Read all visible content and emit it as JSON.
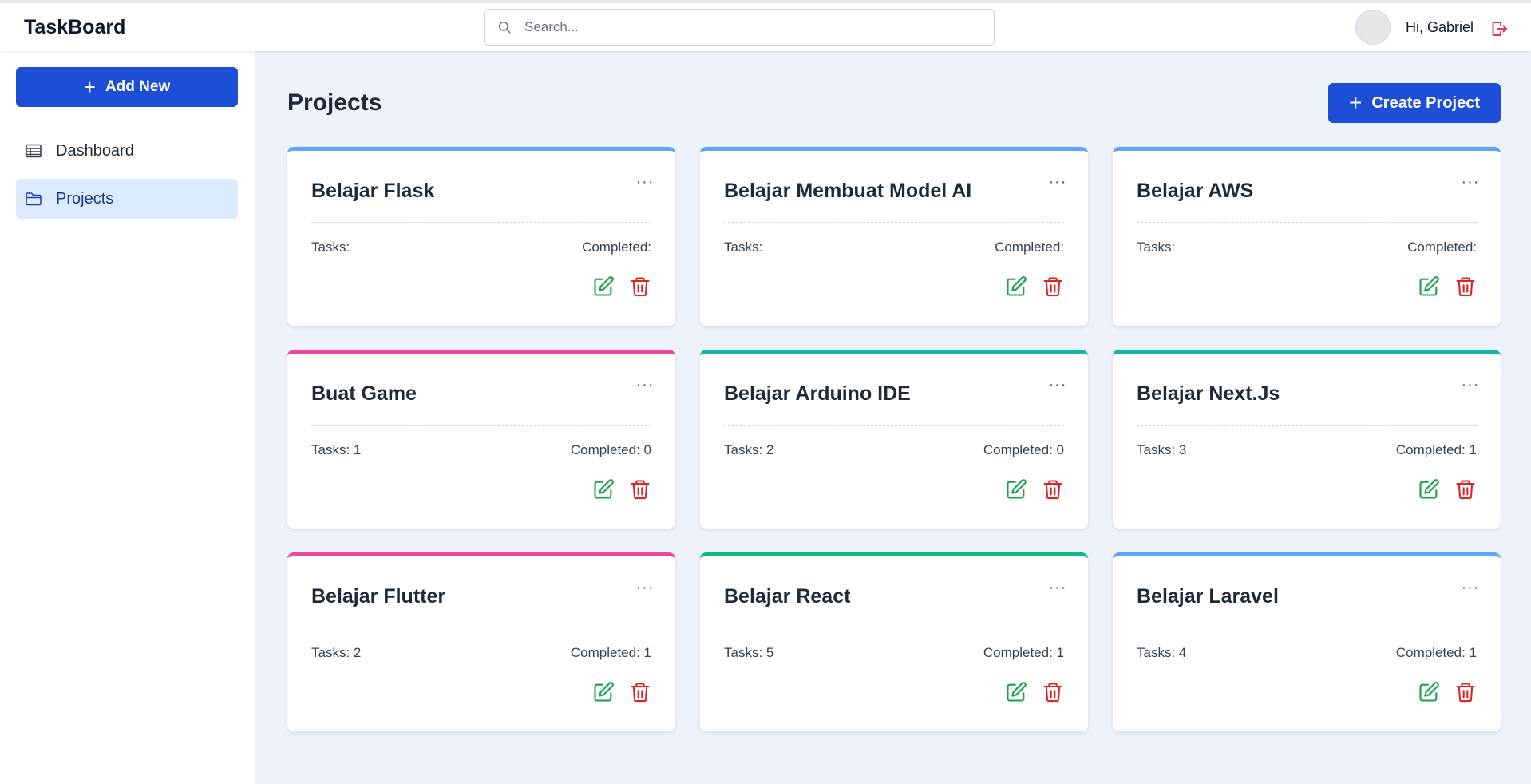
{
  "app": {
    "brand": "TaskBoard"
  },
  "search": {
    "placeholder": "Search..."
  },
  "user": {
    "greeting": "Hi, Gabriel"
  },
  "sidebar": {
    "add_new_label": "Add New",
    "items": [
      {
        "label": "Dashboard",
        "icon": "table-icon"
      },
      {
        "label": "Projects",
        "icon": "folder-icon",
        "active": true
      }
    ]
  },
  "main": {
    "title": "Projects",
    "create_label": "Create Project"
  },
  "colors": {
    "primary": "#1d4ed8",
    "blue": "#60a5fa",
    "pink": "#ec4899",
    "teal": "#14b8a6",
    "green": "#10b981",
    "edit": "#16a34a",
    "delete": "#dc2626"
  },
  "projects": [
    {
      "name": "Belajar Flask",
      "tasks": "Tasks:",
      "completed": "Completed:",
      "accent": "#60a5fa"
    },
    {
      "name": "Belajar Membuat Model AI",
      "tasks": "Tasks:",
      "completed": "Completed:",
      "accent": "#60a5fa"
    },
    {
      "name": "Belajar AWS",
      "tasks": "Tasks:",
      "completed": "Completed:",
      "accent": "#60a5fa"
    },
    {
      "name": "Buat Game",
      "tasks": "Tasks: 1",
      "completed": "Completed: 0",
      "accent": "#ec4899"
    },
    {
      "name": "Belajar Arduino IDE",
      "tasks": "Tasks: 2",
      "completed": "Completed: 0",
      "accent": "#14b8a6"
    },
    {
      "name": "Belajar Next.Js",
      "tasks": "Tasks: 3",
      "completed": "Completed: 1",
      "accent": "#14b8a6"
    },
    {
      "name": "Belajar Flutter",
      "tasks": "Tasks: 2",
      "completed": "Completed: 1",
      "accent": "#ec4899"
    },
    {
      "name": "Belajar React",
      "tasks": "Tasks: 5",
      "completed": "Completed: 1",
      "accent": "#10b981"
    },
    {
      "name": "Belajar Laravel",
      "tasks": "Tasks: 4",
      "completed": "Completed: 1",
      "accent": "#60a5fa"
    }
  ]
}
